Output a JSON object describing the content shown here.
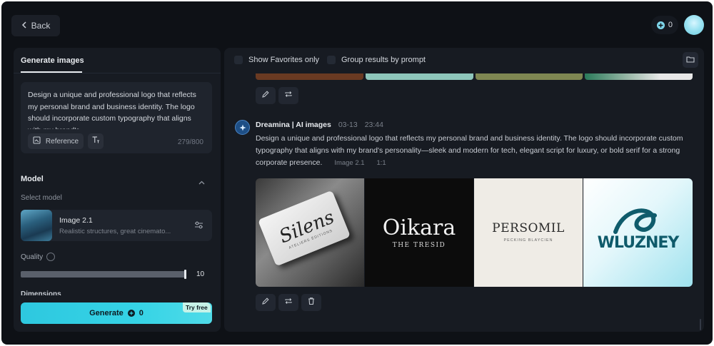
{
  "topbar": {
    "back_label": "Back",
    "credits": "0"
  },
  "left_panel": {
    "tab_label": "Generate images",
    "prompt_text": "Design a unique and professional logo that reflects my personal brand and business identity. The logo should incorporate custom typography that aligns with my brand's",
    "reference_label": "Reference",
    "char_counter": "279/800",
    "model_section_title": "Model",
    "select_model_label": "Select model",
    "model_name": "Image 2.1",
    "model_description": "Realistic structures, great cinemato...",
    "quality_label": "Quality",
    "quality_value": "10",
    "quality_level_fraction": 1.0,
    "dimensions_label": "Dimensions",
    "generate_label": "Generate",
    "generate_cost": "0",
    "try_free_badge": "Try free"
  },
  "results": {
    "show_favorites_label": "Show Favorites only",
    "group_by_prompt_label": "Group results by prompt",
    "generation": {
      "author": "Dreamina | AI images",
      "date": "03-13",
      "time": "23:44",
      "prompt": "Design a unique and professional logo that reflects my personal brand and business identity. The logo should incorporate custom typography that aligns with my brand's personality—sleek and modern for tech, elegant script for luxury, or bold serif for a strong corporate presence.",
      "model_tag": "Image 2.1",
      "ratio_tag": "1:1",
      "images": [
        {
          "logo_text": "Silens",
          "subtext": "ATELIERS ÉDITIONS"
        },
        {
          "logo_text": "Oikara",
          "subtext": "THE TRESID"
        },
        {
          "logo_text": "PERSOMIL",
          "subtext": "PECKING BLAYCIEN"
        },
        {
          "logo_text": "WLUZNEY",
          "subtext": ""
        }
      ]
    }
  },
  "colors": {
    "accent": "#35d3e6",
    "background": "#0e1116",
    "panel": "#171b22"
  }
}
